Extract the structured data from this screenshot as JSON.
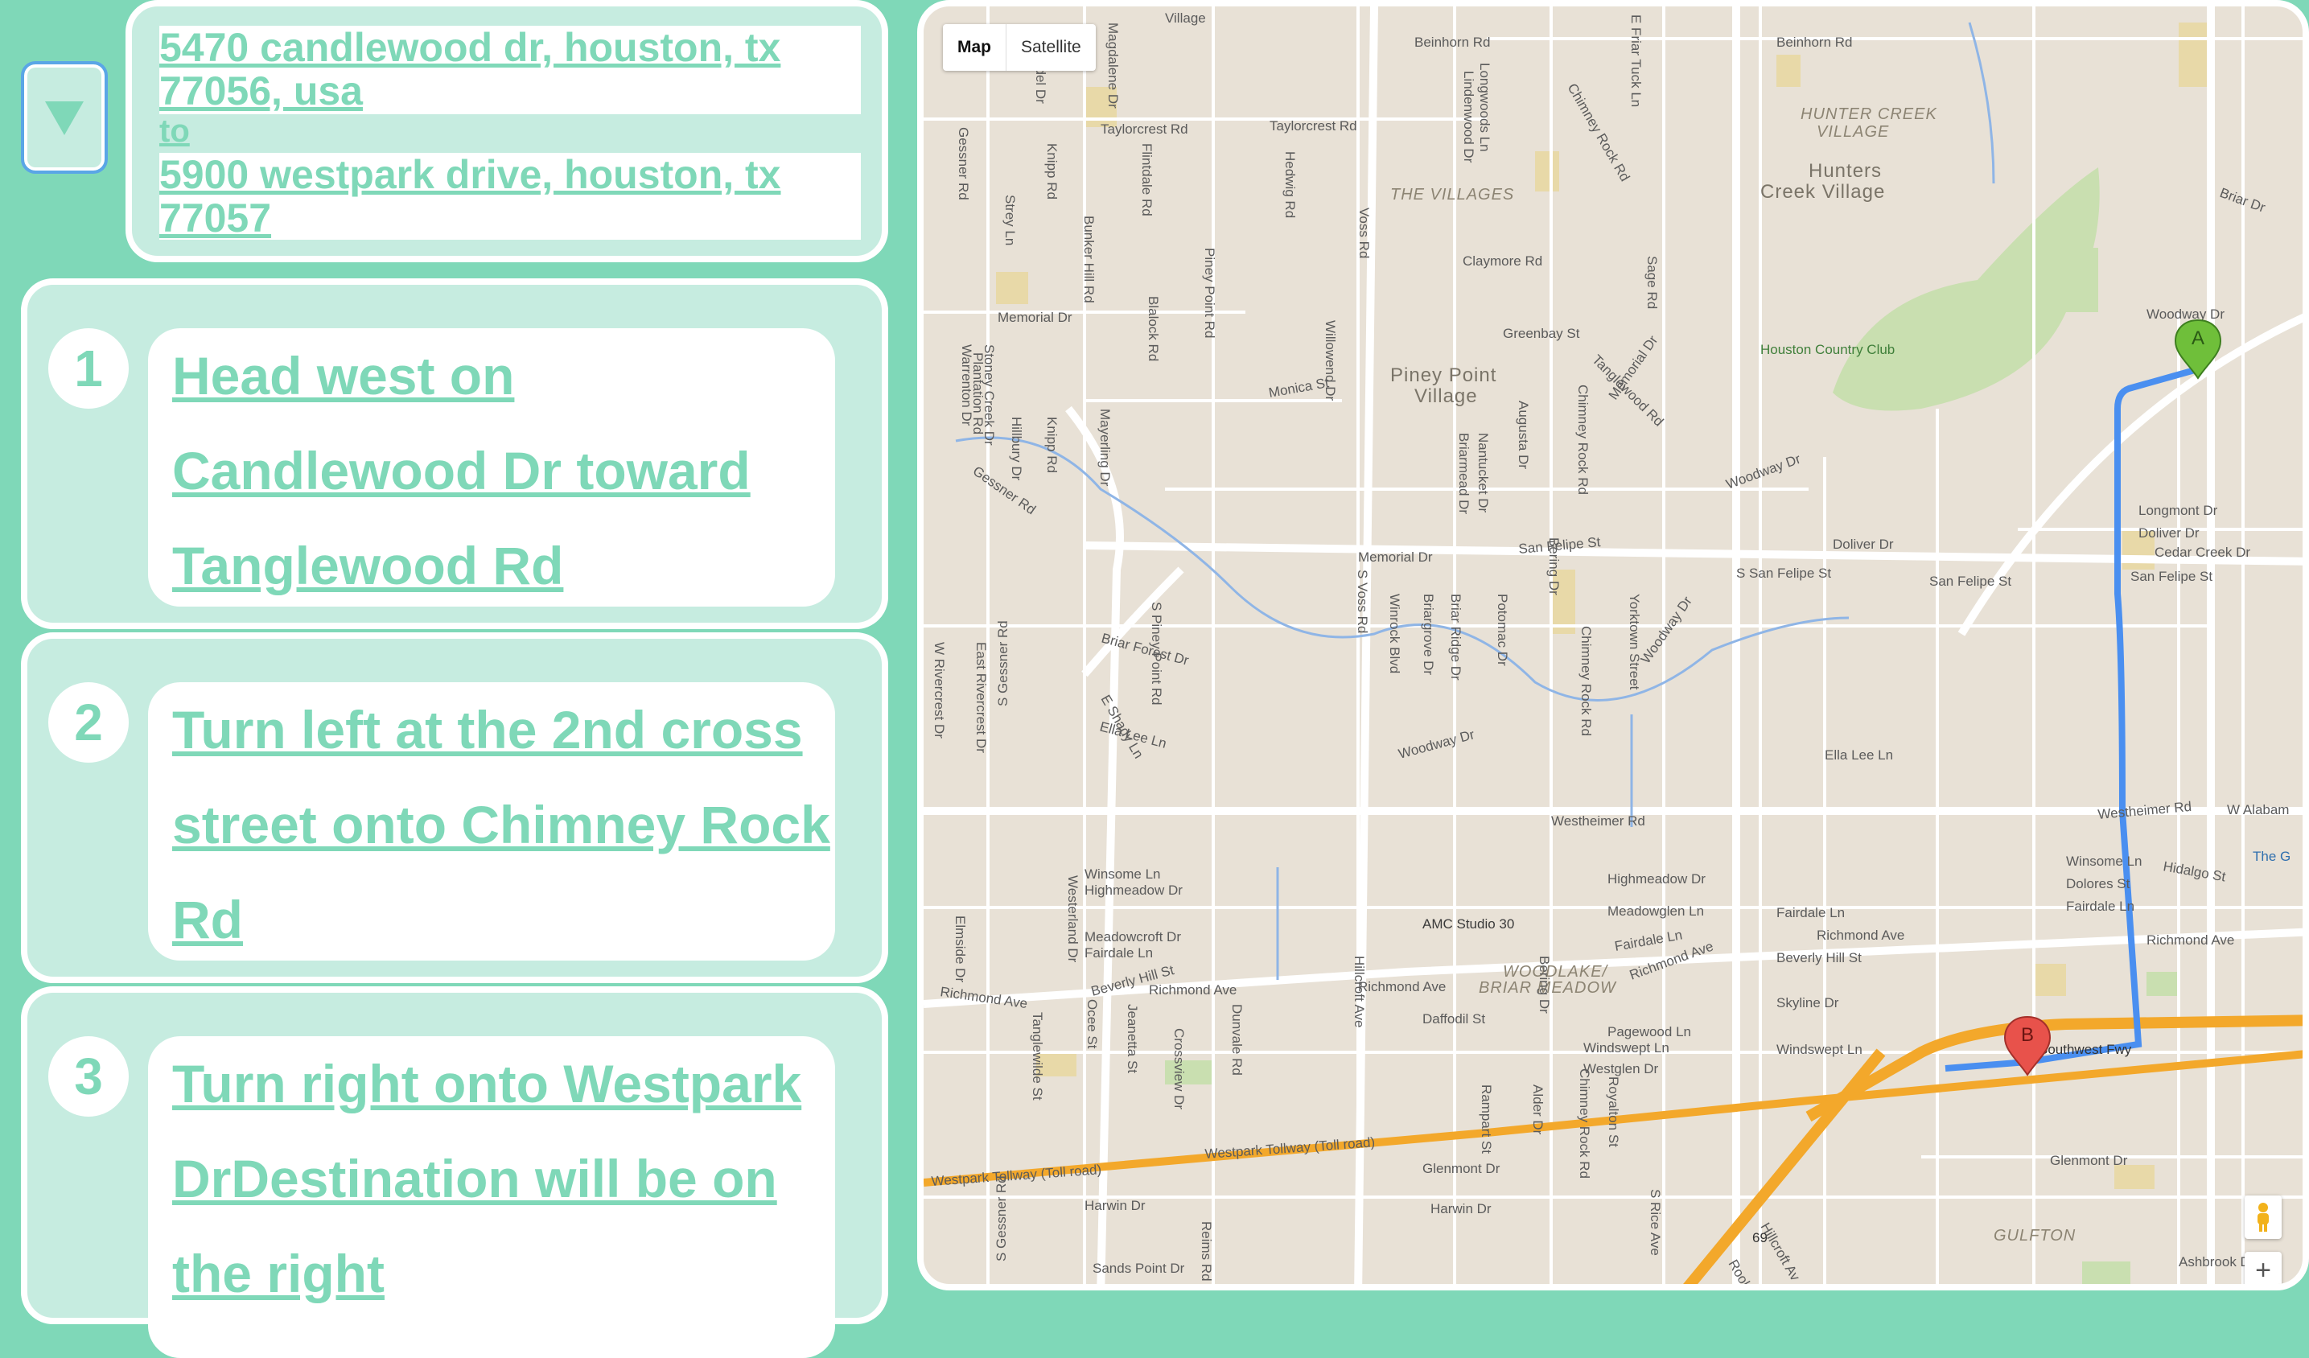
{
  "route": {
    "from": "5470 candlewood dr, houston, tx 77056, usa",
    "to_label": "to",
    "to": "5900 westpark drive, houston, tx 77057"
  },
  "steps": [
    {
      "number": "1",
      "text": "Head west on Candlewood Dr toward Tanglewood Rd"
    },
    {
      "number": "2",
      "text": "Turn left at the 2nd cross street onto Chimney Rock Rd"
    },
    {
      "number": "3",
      "text": "Turn right onto Westpark DrDestination will be on the right"
    }
  ],
  "map": {
    "type_options": [
      "Map",
      "Satellite"
    ],
    "active_type": "Map",
    "zoom_in_label": "+",
    "markers": {
      "start": "A",
      "end": "B"
    },
    "route_color": "#4a8ff0",
    "highway_color": "#f3a82b",
    "labels": {
      "village_top": "Village",
      "beinhorn_1": "Beinhorn Rd",
      "beinhorn_2": "Beinhorn Rd",
      "hunter_creek": "HUNTER CREEK",
      "hunter_village": "VILLAGE",
      "hunters_creek_1": "Hunters",
      "hunters_creek_2": "Creek Village",
      "the_villages": "THE VILLAGES",
      "taylorcrest_1": "Taylorcrest Rd",
      "taylorcrest_2": "Taylorcrest Rd",
      "claymore": "Claymore Rd",
      "greenbay": "Greenbay St",
      "memorial_dr_1": "Memorial Dr",
      "memorial_dr_2": "Memorial Dr",
      "memorial_dr_3": "Memorial Dr",
      "houston_cc": "Houston Country Club",
      "woodway_1": "Woodway Dr",
      "woodway_2": "Woodway Dr",
      "woodway_3": "Woodway Dr",
      "woodway_4": "Woodway Dr",
      "piney_point_1": "Piney Point",
      "piney_point_2": "Village",
      "monica": "Monica St",
      "san_felipe_1": "San Felipe St",
      "san_felipe_2": "S San Felipe St",
      "san_felipe_3": "San Felipe St",
      "san_felipe_4": "San Felipe St",
      "doliver_1": "Doliver Dr",
      "doliver_2": "Doliver Dr",
      "longmont": "Longmont Dr",
      "cedar_creek": "Cedar Creek Dr",
      "briar_forest": "Briar Forest Dr",
      "ella_lee_1": "Ella Lee Ln",
      "ella_lee_2": "Ella Lee Ln",
      "westheimer_1": "Westheimer Rd",
      "westheimer_2": "Westheimer Rd",
      "w_alabama": "W Alabam",
      "the_g": "The G",
      "winsome_1": "Winsome Ln",
      "winsome_2": "Winsome Ln",
      "highmeadow_1": "Highmeadow Dr",
      "highmeadow_2": "Highmeadow Dr",
      "dolores": "Dolores St",
      "fairdale_1": "Fairdale Ln",
      "fairdale_2": "Fairdale Ln",
      "fairdale_3": "Fairdale Ln",
      "fairdale_4": "Fairdale Ln",
      "hidalgo": "Hidalgo St",
      "meadowglen": "Meadowglen Ln",
      "meadowcroft": "Meadowcroft Dr",
      "amc": "AMC Studio 30",
      "richmond_1": "Richmond Ave",
      "richmond_2": "Richmond Ave",
      "richmond_3": "Richmond Ave",
      "richmond_4": "Richmond Ave",
      "richmond_5": "Richmond Ave",
      "richmond_6": "Richmond Ave",
      "beverly_1": "Beverly Hill St",
      "beverly_2": "Beverly Hill St",
      "woodlake_1": "WOODLAKE/",
      "woodlake_2": "BRIAR MEADOW",
      "skyline": "Skyline Dr",
      "daffodil": "Daffodil St",
      "pagewood": "Pagewood Ln",
      "windswept_1": "Windswept Ln",
      "windswept_2": "Windswept Ln",
      "westglen": "Westglen Dr",
      "southwest_fwy": "Southwest Fwy",
      "westpark_1": "Westpark Tollway (Toll road)",
      "westpark_2": "Westpark Tollway (Toll road)",
      "glenmont_1": "Glenmont Dr",
      "glenmont_2": "Glenmont Dr",
      "harwin_1": "Harwin Dr",
      "harwin_2": "Harwin Dr",
      "sands_point": "Sands Point Dr",
      "gulfton": "GULFTON",
      "ashbrook": "Ashbrook Dr",
      "hwy_69": "69",
      "briar_dr": "Briar Dr",
      "hillcroft": "Hillcroft Av",
      "rookin": "Rookin"
    },
    "vertical_labels": {
      "gessner_1": "Gessner Rd",
      "gessner_2": "Gessner Rd",
      "gessner_3": "S Gessner Rd",
      "gessner_4": "S Gessner Rd",
      "bunker_hill": "Bunker Hill Rd",
      "flintdale": "Flintdale Rd",
      "blalock": "Blalock Rd",
      "piney_point_rd": "Piney Point Rd",
      "s_piney_point": "S Piney Point Rd",
      "voss_1": "Voss Rd",
      "voss_2": "S Voss Rd",
      "hedwig": "Hedwig Rd",
      "chimney_rock_1": "Chimney Rock Rd",
      "chimney_rock_2": "Chimney Rock Rd",
      "chimney_rock_3": "Chimney Rock Rd",
      "chimney_rock_4": "Chimney Rock Rd",
      "tanglewood": "Tanglewood Rd",
      "augusta": "Augusta Dr",
      "briarmead": "Briarmead Dr",
      "nantucket": "Nantucket Dr",
      "bering_1": "Bering Dr",
      "bering_2": "Bering Dr",
      "yorktown": "Yorktown Street",
      "longwoods": "Longwoods Ln",
      "lindenwood": "Lindenwood Dr",
      "riedel": "Riedel Dr",
      "knipp_1": "Knipp Rd",
      "knipp_2": "Knipp Rd",
      "strey": "Strey Ln",
      "hillcroft_v": "Hillcroft Ave",
      "w_rivercrest": "W Rivercrest Dr",
      "e_rivercrest": "East Rivercrest Dr",
      "stoney_creek": "Stoney Creek Dr",
      "plantation": "Plantation Rd",
      "warrenton": "Warrenton Dr",
      "willowend": "Willowend Dr",
      "mayerling": "Mayerling Dr",
      "hillbury": "Hillbury Dr",
      "westerland": "Westerland Dr",
      "elmside": "Elmside Dr",
      "tanglewilde": "Tanglewilde St",
      "jeanetta": "Jeanetta St",
      "crossview": "Crossview Dr",
      "dunvale": "Dunvale Rd",
      "winrock": "Winrock Blvd",
      "briargrove": "Briargrove Dr",
      "briar_ridge": "Briar Ridge Dr",
      "potomac": "Potomac Dr",
      "rampart": "Rampart St",
      "alder": "Alder Dr",
      "royalton": "Royalton St",
      "reims": "Reims Rd",
      "ocee": "Ocee St",
      "s_rice": "S Rice Ave",
      "e_shady": "E Shady Ln",
      "magdalene": "Magdalene Dr",
      "e_friar_tuck": "E Friar Tuck Ln",
      "sage": "Sage Rd"
    }
  }
}
